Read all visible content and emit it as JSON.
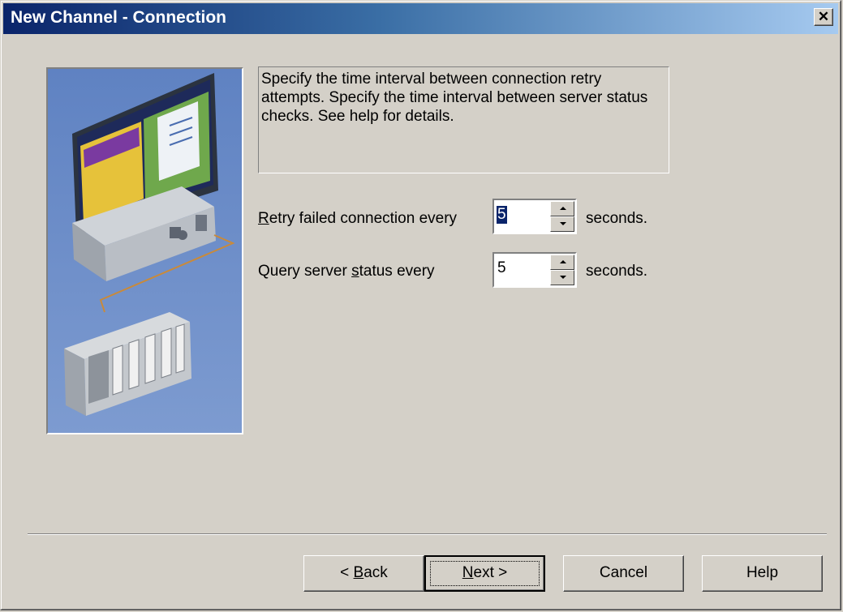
{
  "window": {
    "title": "New Channel - Connection",
    "close_glyph": "✕"
  },
  "description": "Specify the time interval between connection retry attempts. Specify the time interval between server status checks. See help for details.",
  "retry": {
    "label_first": "R",
    "label_rest": "etry failed connection every",
    "value": "5",
    "unit": "seconds."
  },
  "query": {
    "label_pre": "Query server ",
    "label_accel": "s",
    "label_post": "tatus every",
    "value": "5",
    "unit": "seconds."
  },
  "buttons": {
    "back_prefix": "< ",
    "back_accel": "B",
    "back_rest": "ack",
    "next_accel": "N",
    "next_rest": "ext >",
    "cancel": "Cancel",
    "help": "Help"
  },
  "illustration": {
    "name": "pc-connected-to-plc"
  }
}
